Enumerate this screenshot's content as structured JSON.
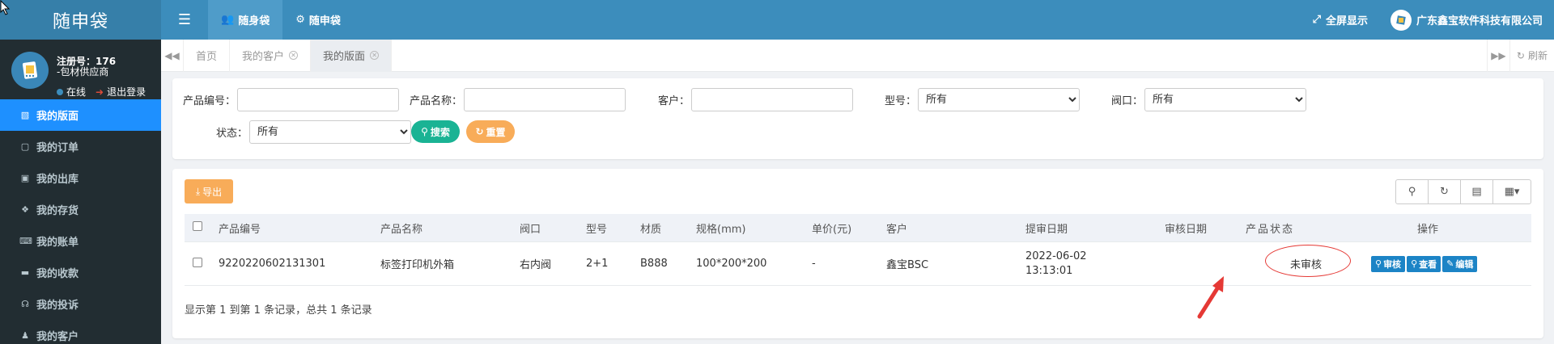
{
  "header": {
    "brand": "随申袋",
    "tabs": [
      {
        "label": "随身袋",
        "active": true
      },
      {
        "label": "随申袋",
        "active": false
      }
    ],
    "fullscreen": "全屏显示",
    "company": "广东鑫宝软件科技有限公司"
  },
  "user": {
    "reg_no": "注册号：176",
    "role": "-包材供应商",
    "status": "在线",
    "logout": "退出登录"
  },
  "sidebar": {
    "items": [
      {
        "label": "我的版面",
        "icon": "layout-icon",
        "active": true
      },
      {
        "label": "我的订单",
        "icon": "monitor-icon",
        "active": false
      },
      {
        "label": "我的出库",
        "icon": "bus-icon",
        "active": false
      },
      {
        "label": "我的存货",
        "icon": "cubes-icon",
        "active": false
      },
      {
        "label": "我的账单",
        "icon": "keyboard-icon",
        "active": false
      },
      {
        "label": "我的收款",
        "icon": "card-icon",
        "active": false
      },
      {
        "label": "我的投诉",
        "icon": "headset-icon",
        "active": false
      },
      {
        "label": "我的客户",
        "icon": "users-icon",
        "active": false
      }
    ]
  },
  "tabbar": {
    "tabs": [
      {
        "label": "首页",
        "closable": false,
        "active": false
      },
      {
        "label": "我的客户",
        "closable": true,
        "active": false
      },
      {
        "label": "我的版面",
        "closable": true,
        "active": true
      }
    ],
    "refresh": "刷新"
  },
  "search": {
    "product_code_label": "产品编号：",
    "product_name_label": "产品名称：",
    "customer_label": "客户：",
    "model_label": "型号：",
    "model_value": "所有",
    "valve_label": "阀口：",
    "valve_value": "所有",
    "status_label": "状态：",
    "status_value": "所有",
    "search_btn": "搜索",
    "reset_btn": "重置"
  },
  "table": {
    "export_btn": "导出",
    "columns": [
      "产品编号",
      "产品名称",
      "阀口",
      "型号",
      "材质",
      "规格(mm)",
      "单价(元)",
      "客户",
      "提审日期",
      "审核日期",
      "产品状态",
      "操作"
    ],
    "rows": [
      {
        "code": "9220220602131301",
        "name": "标签打印机外箱",
        "valve": "右内阀",
        "model": "2+1",
        "material": "B888",
        "spec": "100*200*200",
        "price": "-",
        "customer": "鑫宝BSC",
        "submit_date": "2022-06-02",
        "submit_time": "13:13:01",
        "review_date": "",
        "status": "未审核",
        "actions": {
          "review": "审核",
          "view": "查看",
          "edit": "编辑"
        }
      }
    ],
    "summary": "显示第 1 到第 1 条记录，总共 1 条记录"
  },
  "colors": {
    "header": "#3c8dbc",
    "sidebar": "#222d32",
    "active_menu": "#1e90ff",
    "success": "#1ab394",
    "warning": "#f8ac59",
    "primary_btn": "#1c84c6",
    "annotation": "#e53935"
  }
}
